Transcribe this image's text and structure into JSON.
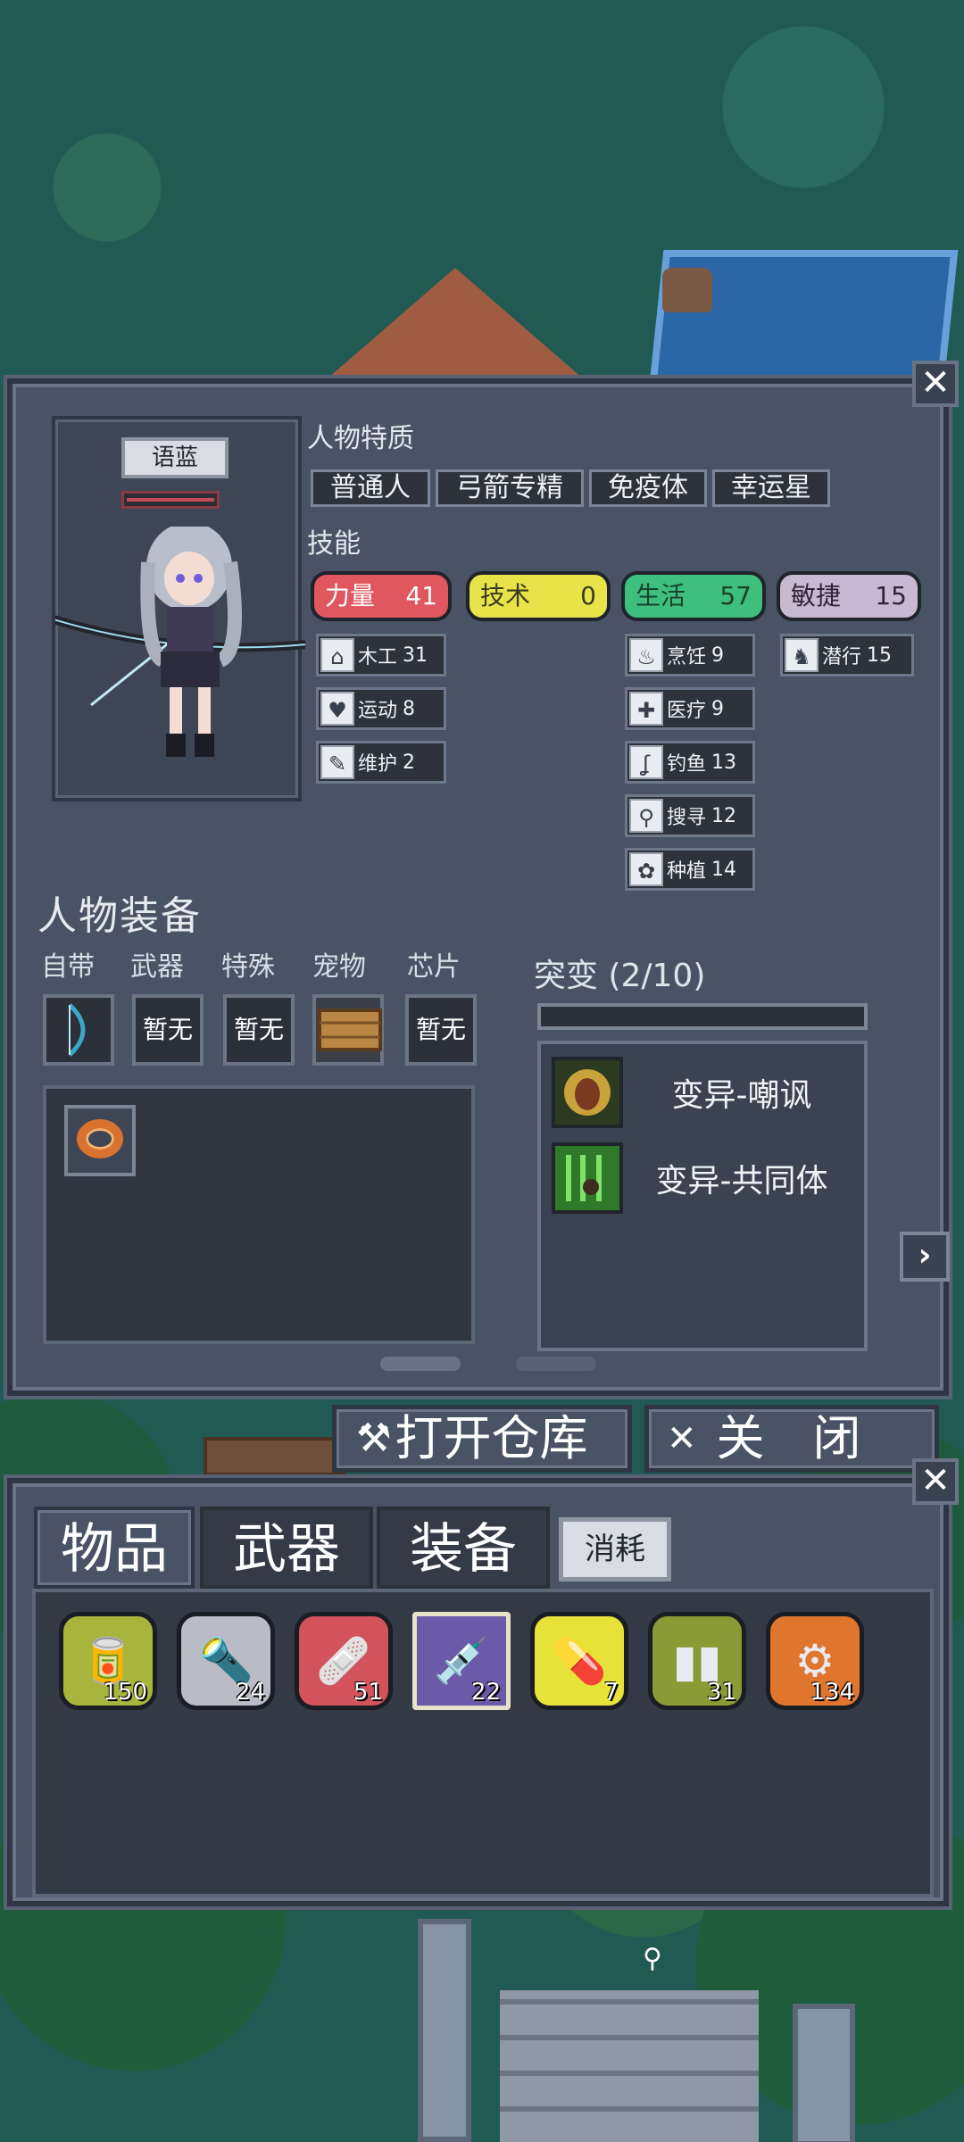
{
  "character": {
    "name": "语蓝",
    "traits_title": "人物特质",
    "traits": [
      "普通人",
      "弓箭专精",
      "免疫体",
      "幸运星"
    ],
    "skills_title": "技能",
    "attributes": [
      {
        "name": "力量",
        "value": "41",
        "color": "#e0575f"
      },
      {
        "name": "技术",
        "value": "0",
        "color": "#e9e34a"
      },
      {
        "name": "生活",
        "value": "57",
        "color": "#3fbf7d"
      },
      {
        "name": "敏捷",
        "value": "15",
        "color": "#c9b8d2"
      }
    ],
    "skills": {
      "strength": [
        {
          "icon": "house-icon",
          "label": "木工",
          "value": "31"
        },
        {
          "icon": "heart-icon",
          "label": "运动",
          "value": "8"
        },
        {
          "icon": "wrench-icon",
          "label": "维护",
          "value": "2"
        }
      ],
      "life": [
        {
          "icon": "pot-icon",
          "label": "烹饪",
          "value": "9"
        },
        {
          "icon": "medkit-icon",
          "label": "医疗",
          "value": "9"
        },
        {
          "icon": "fishing-icon",
          "label": "钓鱼",
          "value": "13"
        },
        {
          "icon": "magnifier-icon",
          "label": "搜寻",
          "value": "12"
        },
        {
          "icon": "flower-icon",
          "label": "种植",
          "value": "14"
        }
      ],
      "agility": [
        {
          "icon": "sneak-icon",
          "label": "潜行",
          "value": "15"
        }
      ]
    }
  },
  "equipment": {
    "title": "人物装备",
    "slots": [
      {
        "label": "自带",
        "value": ""
      },
      {
        "label": "武器",
        "value": "暂无"
      },
      {
        "label": "特殊",
        "value": "暂无"
      },
      {
        "label": "宠物",
        "value": ""
      },
      {
        "label": "芯片",
        "value": "暂无"
      }
    ]
  },
  "mutation": {
    "title": "突变 (2/10)",
    "items": [
      {
        "name": "变异-嘲讽",
        "icon": "taunt-face-icon"
      },
      {
        "name": "变异-共同体",
        "icon": "community-icon"
      }
    ]
  },
  "buttons": {
    "open_storage": "打开仓库",
    "close": "关　闭"
  },
  "inventory": {
    "tabs": [
      "物品",
      "武器",
      "装备"
    ],
    "active_tab": "物品",
    "small_tab": "消耗",
    "items": [
      {
        "icon": "supplies-icon",
        "count": "150",
        "color": "#a8b53c"
      },
      {
        "icon": "flashlight-icon",
        "count": "24",
        "color": "#b9bcc7"
      },
      {
        "icon": "bandage-icon",
        "count": "51",
        "color": "#d2535c"
      },
      {
        "icon": "syringe-card-icon",
        "count": "22",
        "color": "#6b5aa8"
      },
      {
        "icon": "pill-bottle-icon",
        "count": "7",
        "color": "#e6e238"
      },
      {
        "icon": "pads-icon",
        "count": "31",
        "color": "#8a9a34"
      },
      {
        "icon": "bolt-pack-icon",
        "count": "134",
        "color": "#e0762e"
      }
    ]
  }
}
